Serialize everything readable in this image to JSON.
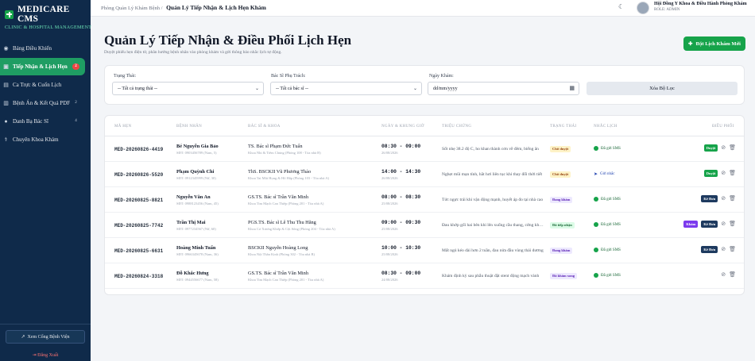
{
  "sidebar": {
    "brand_title": "MEDICARE CMS",
    "brand_sub": "CLINIC & HOSPITAL MANAGEMENT",
    "items": [
      {
        "label": "Bảng Điều Khiển",
        "icon": "dashboard-icon",
        "glyph": "◉",
        "badge": ""
      },
      {
        "label": "Tiếp Nhận & Lịch Hẹn",
        "icon": "calendar-icon",
        "glyph": "▣",
        "badge": "2"
      },
      {
        "label": "Ca Trực & Cuốn Lịch",
        "icon": "clock-icon",
        "glyph": "▤",
        "badge": ""
      },
      {
        "label": "Bệnh Án & Kết Quả PDF",
        "icon": "file-icon",
        "glyph": "▥",
        "badge": "2"
      },
      {
        "label": "Danh Bạ Bác Sĩ",
        "icon": "user-icon",
        "glyph": "●",
        "badge": "4"
      },
      {
        "label": "Chuyên Khoa Khám",
        "icon": "stethoscope-icon",
        "glyph": "⚕",
        "badge": ""
      }
    ],
    "portal_label": "Xem Cổng Bệnh Viện",
    "logout_label": "Đăng Xuất"
  },
  "topbar": {
    "crumb_parent": "Phòng Quản Lý Khám Bệnh /",
    "crumb_current": "Quản Lý Tiếp Nhận & Lịch Hẹn Khám",
    "user_name": "Hội Đồng Y Khoa & Điều Hành Phòng Khám",
    "user_role": "ROLE: ADMIN"
  },
  "header": {
    "title": "Quản Lý Tiếp Nhận & Điều Phối Lịch Hẹn",
    "subtitle": "Duyệt phiếu hẹn điện tử, phân hướng bệnh nhân vào phòng khám và gửi thông báo nhắc lịch tự động.",
    "new_button": "Đặt Lịch Khám Mới"
  },
  "filters": {
    "status_label": "Trạng Thái:",
    "status_value": "-- Tất cả trạng thái --",
    "doctor_label": "Bác Sĩ Phụ Trách:",
    "doctor_value": "-- Tất cả bác sĩ --",
    "date_label": "Ngày Khám:",
    "date_value": "dd/mm/yyyy",
    "clear_button": "Xóa Bộ Lọc"
  },
  "table": {
    "headers": [
      "MÃ HẸN",
      "BỆNH NHÂN",
      "BÁC SĨ & KHOA",
      "NGÀY & KHUNG GIỜ",
      "TRIỆU CHỨNG",
      "TRẠNG THÁI",
      "NHẮC LỊCH",
      "ĐIỀU PHỐI"
    ],
    "rows": [
      {
        "code": "MED-20260826-4419",
        "name": "Bé Nguyễn Gia Bảo",
        "phone": "SĐT: 0903456789 (Nam, 5)",
        "doctor": "TS. Bác sĩ Phạm Đức Tuấn",
        "dept": "Khoa Nhi & Tiêm Chủng (Phòng 108 - Tòa nhà B)",
        "time": "08:30 - 09:00",
        "date": "26/08/2026",
        "symptom": "Sốt nhẹ 38.2 độ C, ho khan thành cơn về đêm, biếng ăn",
        "status": "Chờ duyệt",
        "status_style": "yellow",
        "remind": "Đã gửi SMS",
        "remind_style": "ok",
        "actions": [
          "Duyệt"
        ],
        "action_style": [
          "green"
        ]
      },
      {
        "code": "MED-20260826-5520",
        "name": "Phạm Quỳnh Chi",
        "phone": "SĐT: 0912345999 (Nữ, 30)",
        "doctor": "ThS. BSCKII Vũ Phương Thảo",
        "dept": "Khoa Tai Mũi Họng & Hô Hấp (Phòng 103 - Tòa nhà A)",
        "time": "14:00 - 14:30",
        "date": "26/08/2026",
        "symptom": "Nghẹt mũi mạn tính, hắt hơi liên tục khi thay đổi thời tiết",
        "status": "Chờ duyệt",
        "status_style": "yellow",
        "remind": "Gửi nhắc",
        "remind_style": "send",
        "actions": [
          "Duyệt"
        ],
        "action_style": [
          "green"
        ]
      },
      {
        "code": "MED-20260825-8821",
        "name": "Nguyễn Văn An",
        "phone": "SĐT: 0988123456 (Nam, 45)",
        "doctor": "GS.TS. Bác sĩ Trần Văn Minh",
        "dept": "Khoa Tim Mạch Can Thiệp (Phòng 201 - Tòa nhà A)",
        "time": "08:00 - 08:30",
        "date": "25/08/2026",
        "symptom": "Tức ngực trái khi vận động mạnh, huyết áp đo tại nhà cao",
        "status": "Đang khám",
        "status_style": "purple",
        "remind": "Đã gửi SMS",
        "remind_style": "ok",
        "actions": [
          "Kê Đơn"
        ],
        "action_style": [
          "navy"
        ]
      },
      {
        "code": "MED-20260825-7742",
        "name": "Trần Thị Mai",
        "phone": "SĐT: 0977234567 (Nữ, 60)",
        "doctor": "PGS.TS. Bác sĩ Lê Thu Thu Hằng",
        "dept": "Khoa Cơ Xương Khớp & Cột Sống (Phòng 204 - Tòa nhà A)",
        "time": "09:00 - 09:30",
        "date": "25/08/2026",
        "symptom": "Đau khớp gối hai bên khi lên xuống cầu thang, cứng khớp buổi sáng",
        "status": "Đã tiếp nhận",
        "status_style": "green",
        "remind": "Đã gửi SMS",
        "remind_style": "ok",
        "actions": [
          "Khám",
          "Kê Đơn"
        ],
        "action_style": [
          "purple",
          "navy"
        ]
      },
      {
        "code": "MED-20260825-6631",
        "name": "Hoàng Minh Tuấn",
        "phone": "SĐT: 0966345678 (Nam, 36)",
        "doctor": "BSCKII Nguyễn Hoàng Long",
        "dept": "Khoa Nội Thần Kinh (Phòng 302 - Tòa nhà B)",
        "time": "10:00 - 10:30",
        "date": "25/08/2026",
        "symptom": "Mất ngủ kéo dài hơn 2 tuần, đau nửa đầu vùng thái dương",
        "status": "Đang khám",
        "status_style": "purple",
        "remind": "Đã gửi SMS",
        "remind_style": "ok",
        "actions": [
          "Kê Đơn"
        ],
        "action_style": [
          "navy"
        ]
      },
      {
        "code": "MED-20260824-3318",
        "name": "Đỗ Khắc Hưng",
        "phone": "SĐT: 0944556677 (Nam, 58)",
        "doctor": "GS.TS. Bác sĩ Trần Văn Minh",
        "dept": "Khoa Tim Mạch Can Thiệp (Phòng 201 - Tòa nhà A)",
        "time": "08:30 - 09:00",
        "date": "24/08/2026",
        "symptom": "Khám định kỳ sau phẫu thuật đặt stent động mạch vành",
        "status": "Đã khám xong",
        "status_style": "purple",
        "remind": "Đã gửi SMS",
        "remind_style": "ok",
        "actions": [],
        "action_style": []
      }
    ]
  }
}
